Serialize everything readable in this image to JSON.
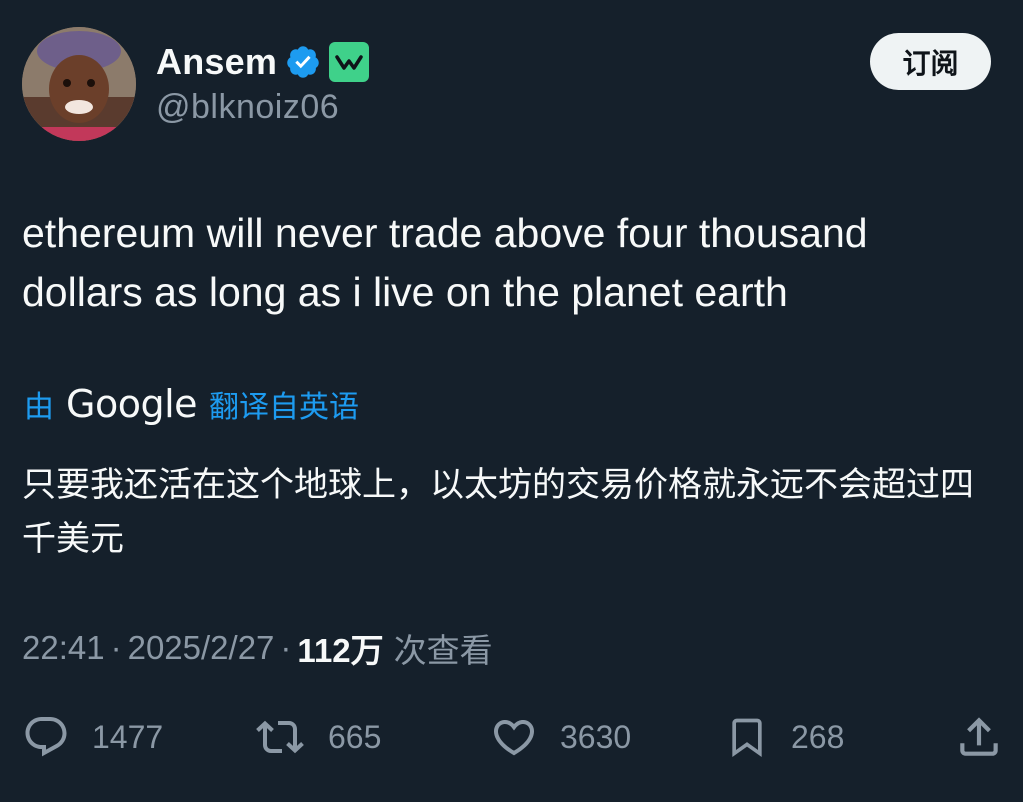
{
  "author": {
    "display_name": "Ansem",
    "handle": "@blknoiz06"
  },
  "header": {
    "subscribe_label": "订阅"
  },
  "tweet": {
    "text": "ethereum will never trade above four thousand dollars as long as i live on the planet earth",
    "translation": {
      "prefix": "由",
      "provider": "Google",
      "suffix": "翻译自英语",
      "text": "只要我还活在这个地球上，以太坊的交易价格就永远不会超过四千美元"
    }
  },
  "meta": {
    "time": "22:41",
    "date": "2025/2/27",
    "separator": "·",
    "views_count": "112万",
    "views_label": "次查看"
  },
  "actions": {
    "replies": "1477",
    "reposts": "665",
    "likes": "3630",
    "bookmarks": "268"
  },
  "colors": {
    "background": "#15202b",
    "accent": "#1d9bf0",
    "secondary_text": "#8b98a5",
    "affiliate_badge": "#3fd18a"
  }
}
